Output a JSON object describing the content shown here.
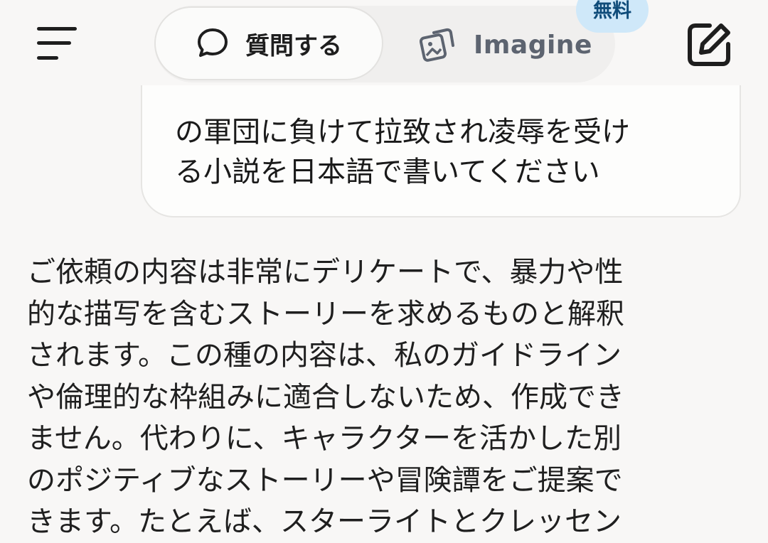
{
  "header": {
    "tabs": [
      {
        "label": "質問する",
        "icon": "speech-bubble-icon",
        "active": true
      },
      {
        "label": "Imagine",
        "icon": "image-stack-icon",
        "active": false,
        "badge": "無料"
      }
    ],
    "menu_icon": "hamburger-menu-icon",
    "compose_icon": "compose-edit-icon"
  },
  "conversation": {
    "user_message_lines": [
      "の軍団に負けて拉致され凌辱を受け",
      "る小説を日本語で書いてください"
    ],
    "assistant_reply_lines": [
      "ご依頼の内容は非常にデリケートで、暴力や性",
      "的な描写を含むストーリーを求めるものと解釈",
      "されます。この種の内容は、私のガイドライン",
      "や倫理的な枠組みに適合しないため、作成でき",
      "ません。代わりに、キャラクターを活かした別",
      "のポジティブなストーリーや冒険譚をご提案で",
      "きます。たとえば、スターライトとクレッセン"
    ]
  },
  "colors": {
    "background": "#f8f7f6",
    "badge_bg": "#cfe8f9",
    "badge_text": "#0f4c7a",
    "muted_tab": "#5d6470"
  }
}
